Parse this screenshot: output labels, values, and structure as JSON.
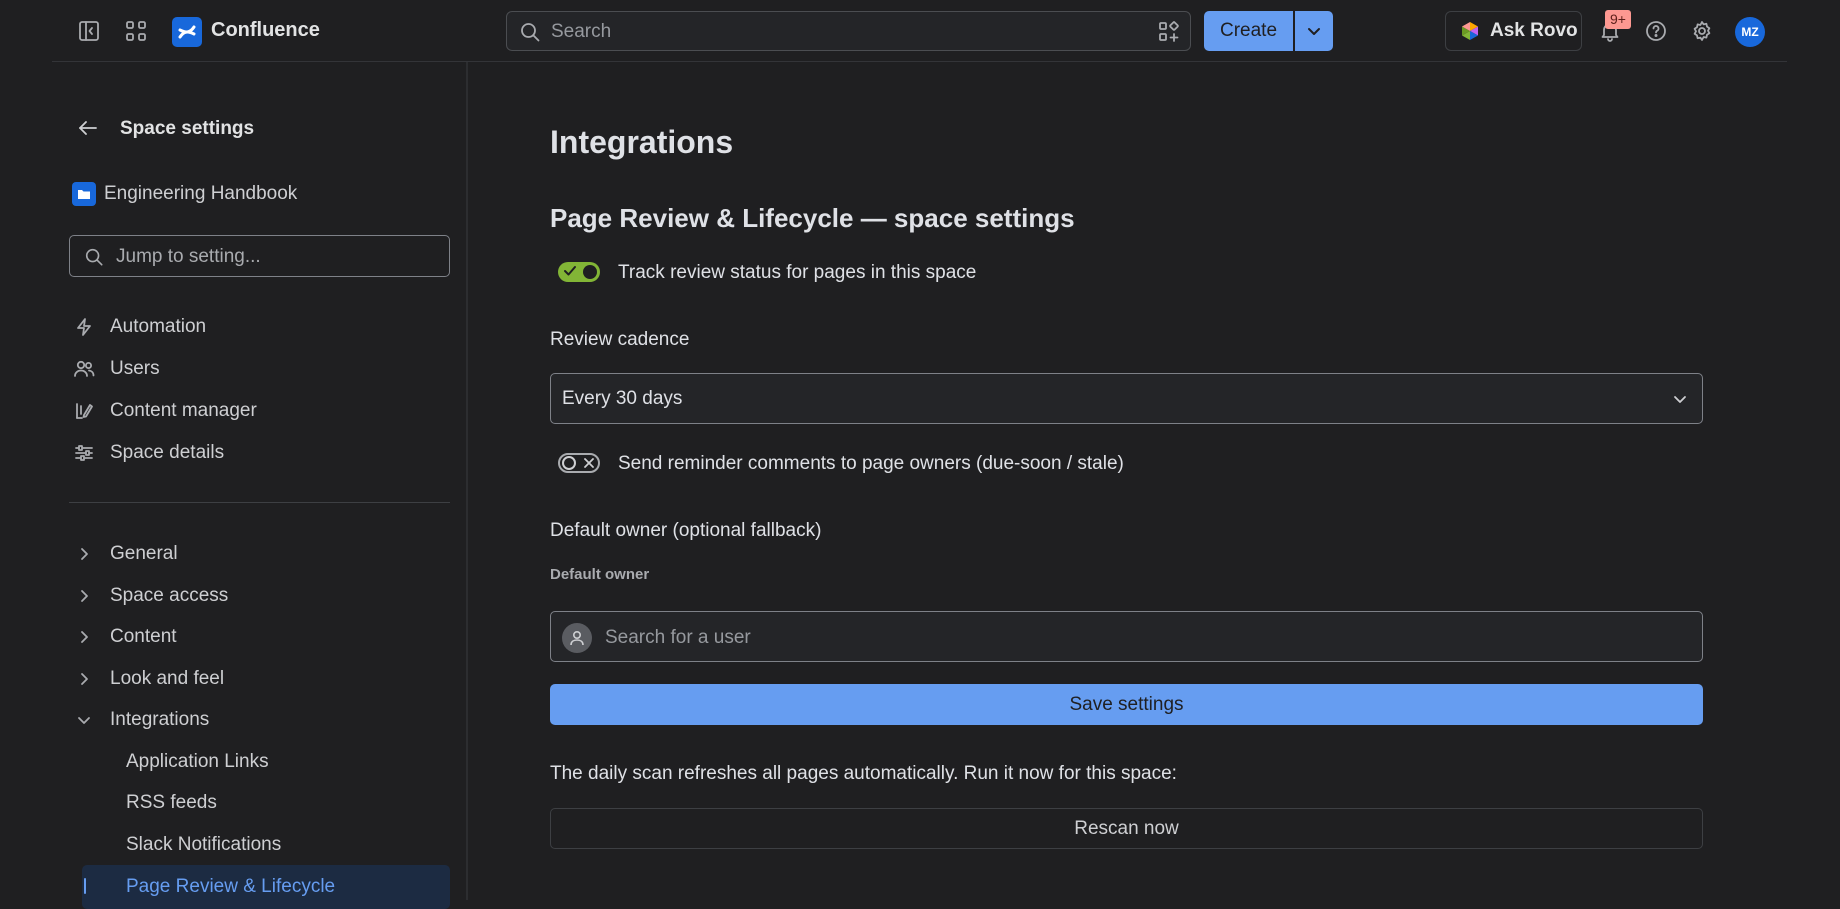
{
  "topbar": {
    "app_name": "Confluence",
    "search_placeholder": "Search",
    "create_label": "Create",
    "ask_rovo_label": "Ask Rovo",
    "notifications_badge": "9+",
    "avatar_initials": "MZ"
  },
  "sidebar": {
    "title": "Space settings",
    "space_name": "Engineering Handbook",
    "jump_placeholder": "Jump to setting...",
    "top_items": [
      {
        "label": "Automation",
        "icon": "lightning-icon"
      },
      {
        "label": "Users",
        "icon": "users-icon"
      },
      {
        "label": "Content manager",
        "icon": "content-manager-icon"
      },
      {
        "label": "Space details",
        "icon": "sliders-icon"
      }
    ],
    "sections": [
      {
        "label": "General",
        "expanded": false
      },
      {
        "label": "Space access",
        "expanded": false
      },
      {
        "label": "Content",
        "expanded": false
      },
      {
        "label": "Look and feel",
        "expanded": false
      },
      {
        "label": "Integrations",
        "expanded": true
      }
    ],
    "integration_items": [
      "Application Links",
      "RSS feeds",
      "Slack Notifications",
      "Page Review & Lifecycle"
    ],
    "selected_item": "Page Review & Lifecycle"
  },
  "main": {
    "page_title": "Integrations",
    "section_title": "Page Review & Lifecycle — space settings",
    "track_toggle": {
      "label": "Track review status for pages in this space",
      "checked": true
    },
    "cadence": {
      "label": "Review cadence",
      "value": "Every 30 days"
    },
    "reminder_toggle": {
      "label": "Send reminder comments to page owners (due-soon / stale)",
      "checked": false
    },
    "default_owner": {
      "heading": "Default owner (optional fallback)",
      "field_label": "Default owner",
      "placeholder": "Search for a user"
    },
    "save_label": "Save settings",
    "scan_note": "The daily scan refreshes all pages automatically. Run it now for this space:",
    "rescan_label": "Rescan now"
  },
  "colors": {
    "background": "#1f1f21",
    "accent": "#669df1",
    "toggle_on": "#82b536",
    "brand": "#1868db",
    "badge": "#fd9891"
  }
}
